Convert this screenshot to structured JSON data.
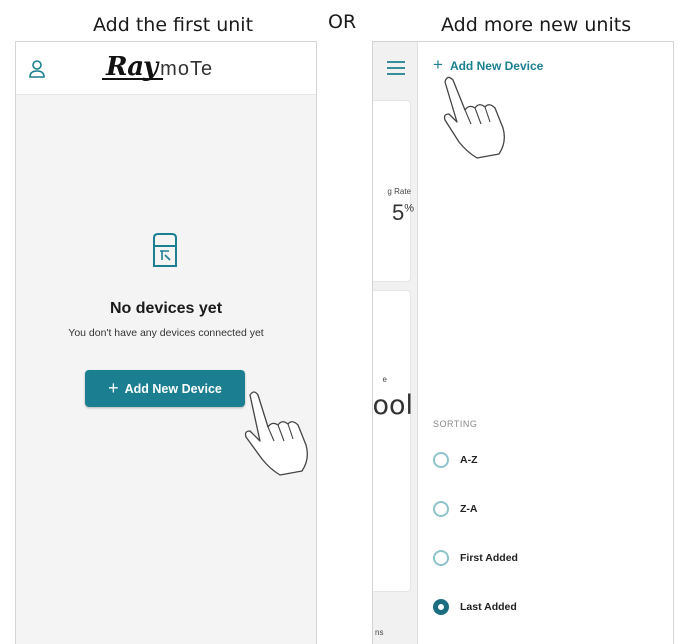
{
  "captions": {
    "left": "Add the first unit",
    "middle": "OR",
    "right": "Add more new units"
  },
  "left_screen": {
    "logo_primary": "Ray",
    "logo_secondary": "moTe",
    "empty_title": "No devices yet",
    "empty_subtitle": "You don't have any devices connected yet",
    "add_button_label": "Add New Device",
    "icons": [
      "user-icon",
      "device-icon",
      "plus-icon",
      "pointing-hand-icon"
    ]
  },
  "right_screen": {
    "add_link_label": "Add New Device",
    "background": {
      "rate_label": "g Rate",
      "rate_value": "5",
      "rate_unit": "%",
      "temp_label": "e",
      "temp_value": "ool",
      "bottom_fragment": "ns"
    },
    "sorting": {
      "heading": "SORTING",
      "options": [
        {
          "label": "A-Z",
          "selected": false
        },
        {
          "label": "Z-A",
          "selected": false
        },
        {
          "label": "First Added",
          "selected": false
        },
        {
          "label": "Last Added",
          "selected": true
        }
      ]
    },
    "icons": [
      "menu-icon",
      "plus-icon",
      "pointing-hand-icon",
      "radio-icon"
    ]
  },
  "colors": {
    "accent": "#1b7f91",
    "radio_selected": "#1b6e7f",
    "radio_unselected": "#8fc3cc",
    "screen_background": "#f4f4f4"
  }
}
